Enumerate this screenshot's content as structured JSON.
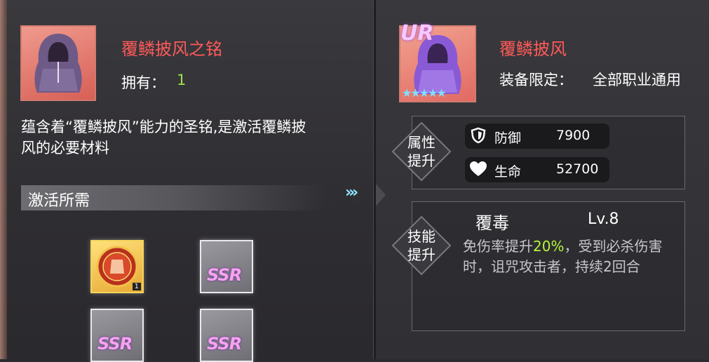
{
  "material": {
    "name": "覆鳞披风之铭",
    "own_label": "拥有：",
    "own_count": "1",
    "description": "蕴含着“覆鳞披风”能力的圣铭,是激活覆鳞披风的必要材料"
  },
  "requirements": {
    "label": "激活所需",
    "slots": [
      {
        "type": "gold",
        "count": "1"
      },
      {
        "type": "ssr",
        "text": "SSR"
      },
      {
        "type": "ssr",
        "text": "SSR"
      },
      {
        "type": "ssr",
        "text": "SSR"
      }
    ]
  },
  "arrows": "›››",
  "equipment": {
    "rarity": "UR",
    "stars": "★★★★★",
    "name": "覆鳞披风",
    "restrict_label": "装备限定：",
    "restrict_value": "全部职业通用"
  },
  "attributes": {
    "section_label_1": "属性",
    "section_label_2": "提升",
    "stats": [
      {
        "icon": "shield-icon",
        "label": "防御",
        "value": "7900"
      },
      {
        "icon": "heart-icon",
        "label": "生命",
        "value": "52700"
      }
    ]
  },
  "skill": {
    "section_label_1": "技能",
    "section_label_2": "提升",
    "name": "覆毒",
    "level": "Lv.8",
    "desc_prefix": "免伤率提升",
    "desc_highlight": "20%",
    "desc_suffix": "，受到必杀伤害时，诅咒攻击者，持续2回合"
  },
  "colors": {
    "name_red": "#ff5a5a",
    "count_green": "#9be34d",
    "highlight_green": "#b6f53a"
  }
}
